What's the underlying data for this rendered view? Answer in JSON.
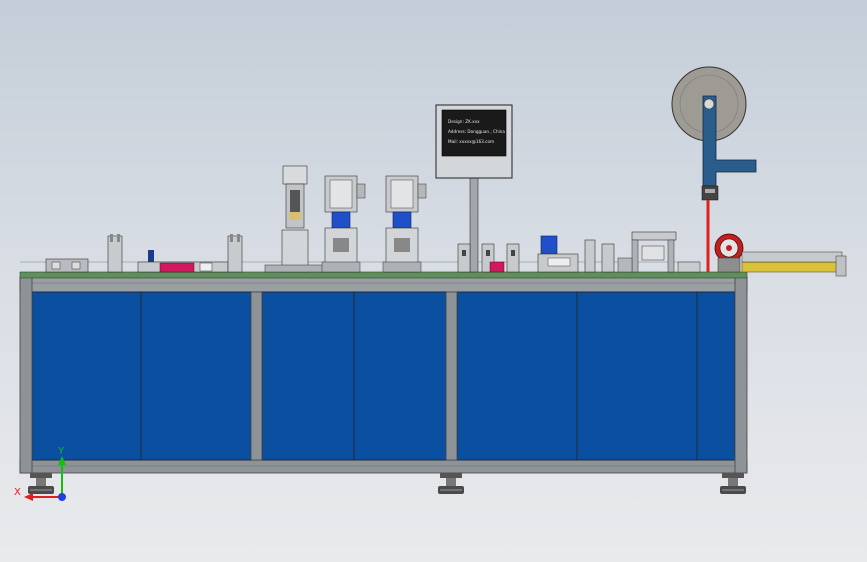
{
  "colors": {
    "background_top": "#c4cdd8",
    "frame_steel": "#8e9397",
    "panel_blue": "#0a4fa0",
    "panel_outline": "#1e2a3a",
    "table_green": "#5f8f5a",
    "accent_magenta": "#d0195e",
    "cylinder_blue": "#2050c8",
    "reel_gray": "#9e9a94",
    "arm_blue": "#2a5d8c",
    "laser_red": "#e02020",
    "conveyor_yellow": "#d9c23a",
    "axis_y": "#10c010",
    "axis_x": "#e02020",
    "axis_z": "#2040e0"
  },
  "hmi_screen": {
    "line1": "Design: ZK.xxx",
    "line2": "Address: Dongguan , China",
    "line3": "Mail: xxxxx@163.com"
  },
  "axis_triad": {
    "y_label": "Y",
    "x_label": "X"
  }
}
